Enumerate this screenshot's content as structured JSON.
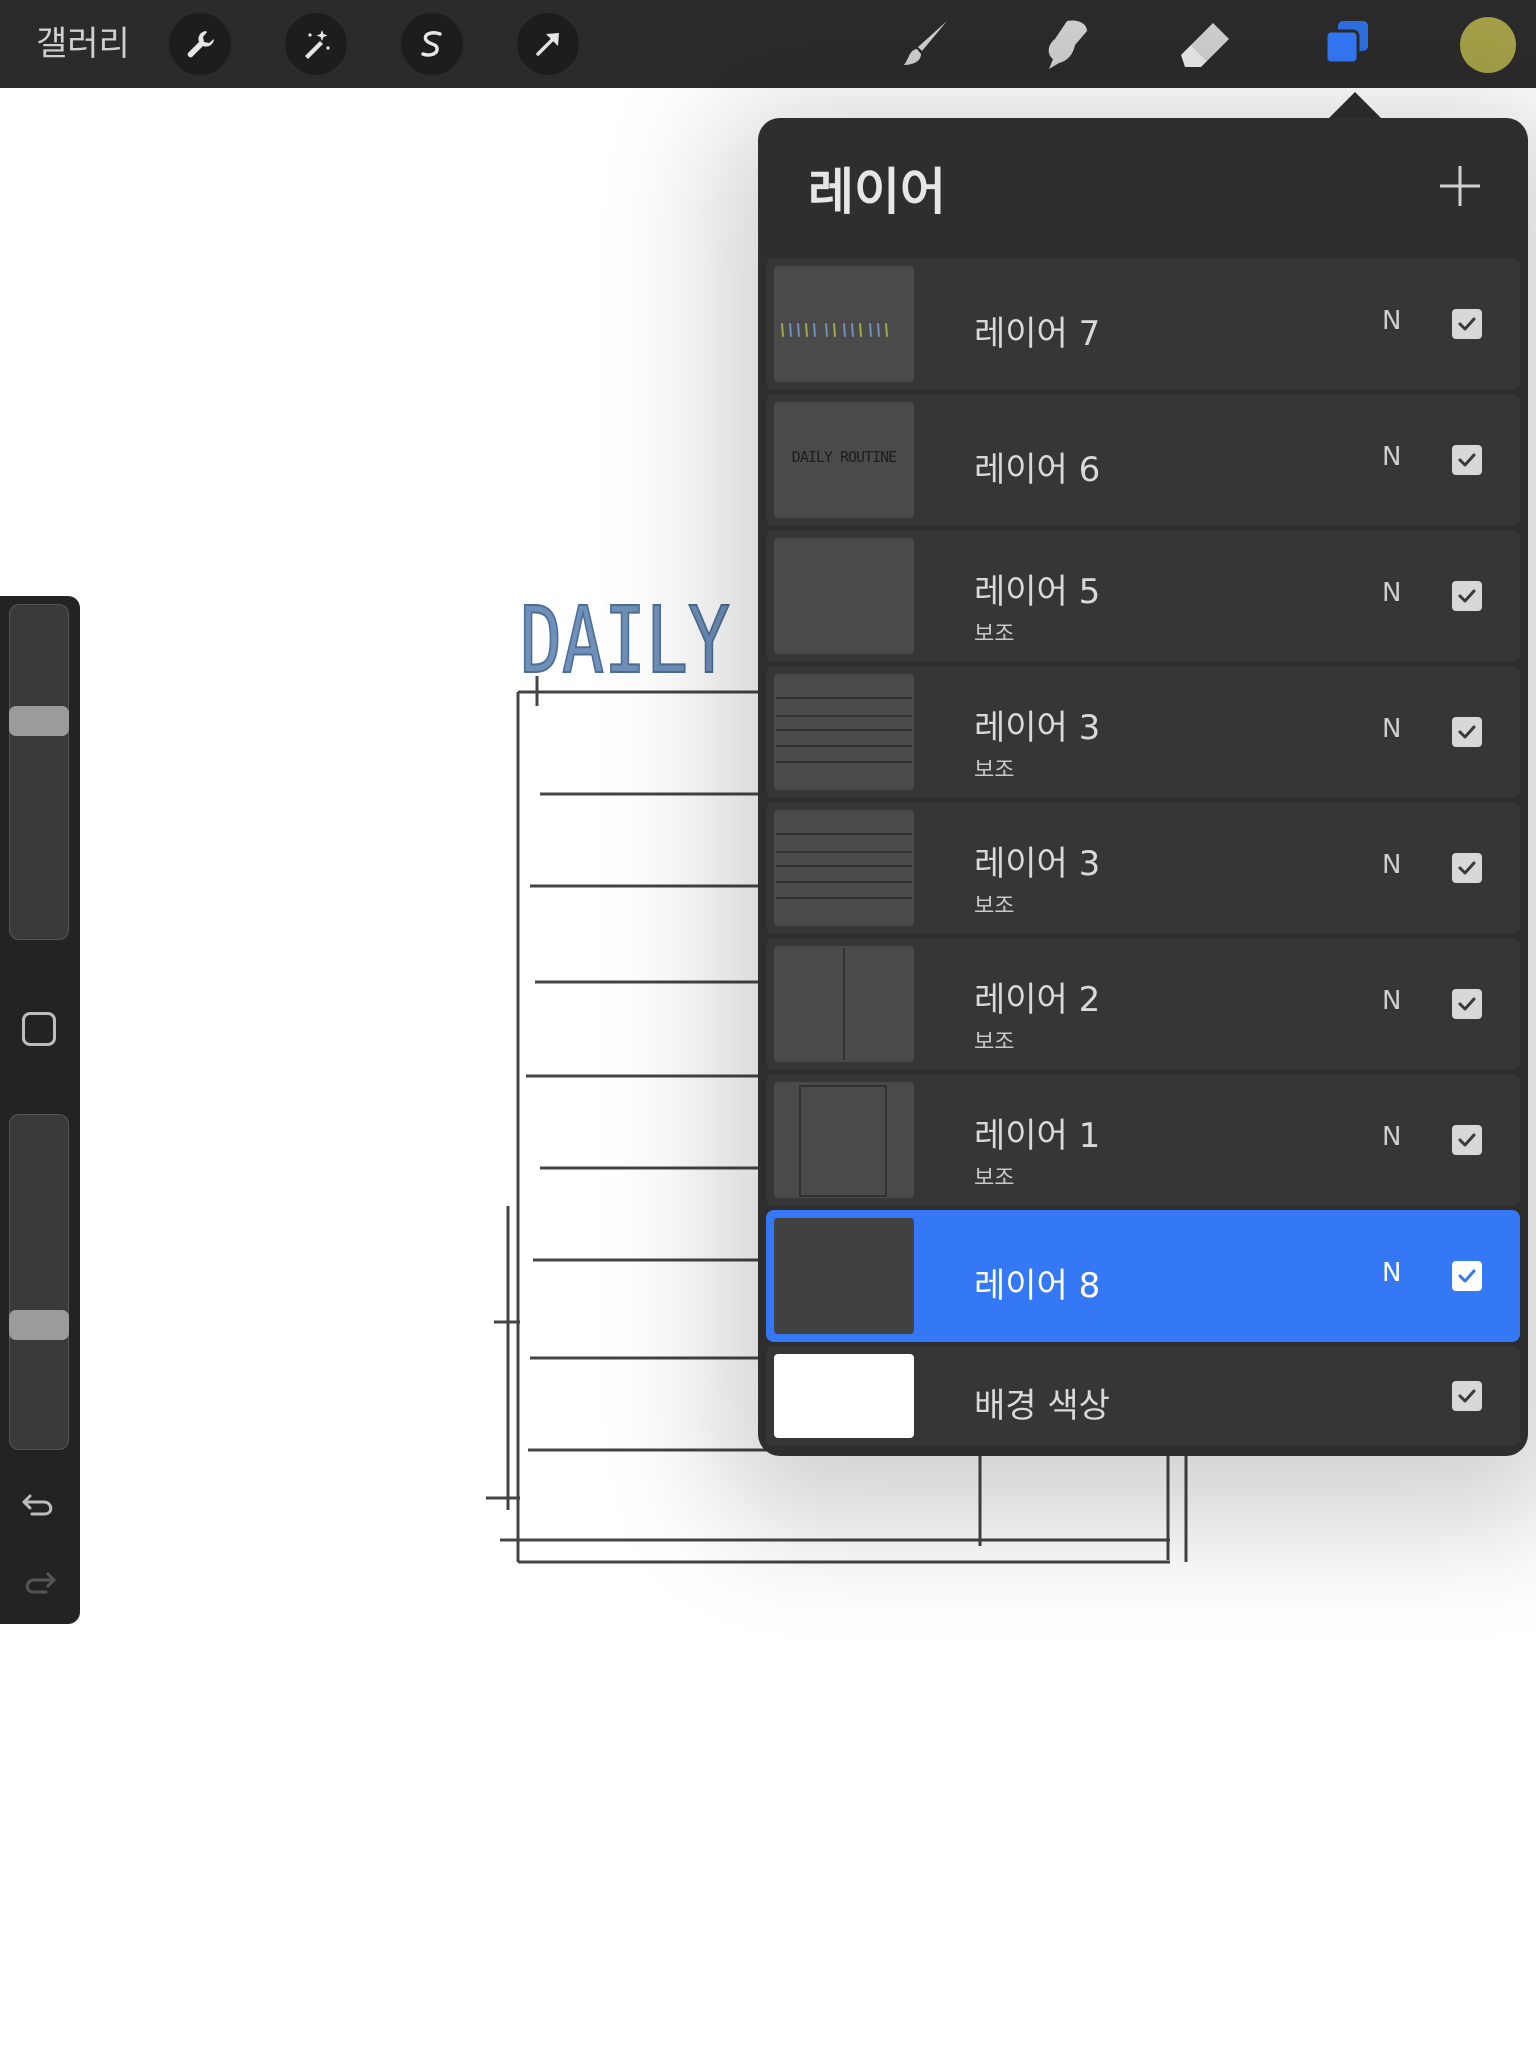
{
  "toolbar": {
    "gallery_label": "갤러리",
    "left_tools": [
      {
        "icon": "wrench-icon"
      },
      {
        "icon": "magic-wand-icon"
      },
      {
        "icon": "selection-s-icon"
      },
      {
        "icon": "transform-arrow-icon"
      }
    ],
    "right_tools": [
      {
        "icon": "brush-icon"
      },
      {
        "icon": "smudge-icon"
      },
      {
        "icon": "eraser-icon"
      },
      {
        "icon": "layers-icon",
        "active": true
      }
    ],
    "current_color": "#a5a048",
    "active_color": "#3478f6"
  },
  "canvas": {
    "title_text": "DAILY"
  },
  "layers_panel": {
    "title": "레이어",
    "add_icon": "plus-icon",
    "layers": [
      {
        "name": "레이어 7",
        "sublabel": "",
        "blend": "N",
        "visible": true,
        "selected": false,
        "thumb": "colored-text"
      },
      {
        "name": "레이어 6",
        "sublabel": "",
        "blend": "N",
        "visible": true,
        "selected": false,
        "thumb": "daily-routine-text",
        "thumb_text": "DAILY ROUTINE"
      },
      {
        "name": "레이어 5",
        "sublabel": "보조",
        "blend": "N",
        "visible": true,
        "selected": false,
        "thumb": "empty"
      },
      {
        "name": "레이어 3",
        "sublabel": "보조",
        "blend": "N",
        "visible": true,
        "selected": false,
        "thumb": "lines"
      },
      {
        "name": "레이어 3",
        "sublabel": "보조",
        "blend": "N",
        "visible": true,
        "selected": false,
        "thumb": "lines"
      },
      {
        "name": "레이어 2",
        "sublabel": "보조",
        "blend": "N",
        "visible": true,
        "selected": false,
        "thumb": "vertical-line"
      },
      {
        "name": "레이어 1",
        "sublabel": "보조",
        "blend": "N",
        "visible": true,
        "selected": false,
        "thumb": "frame"
      },
      {
        "name": "레이어 8",
        "sublabel": "",
        "blend": "N",
        "visible": true,
        "selected": true,
        "thumb": "empty"
      }
    ],
    "background": {
      "name": "배경 색상",
      "visible": true,
      "color": "#ffffff"
    }
  },
  "sidebar": {
    "brush_size_level": 0.68,
    "opacity_level": 0.35,
    "modify_icon": "square-modify-icon",
    "undo_icon": "undo-icon",
    "redo_icon": "redo-icon"
  }
}
